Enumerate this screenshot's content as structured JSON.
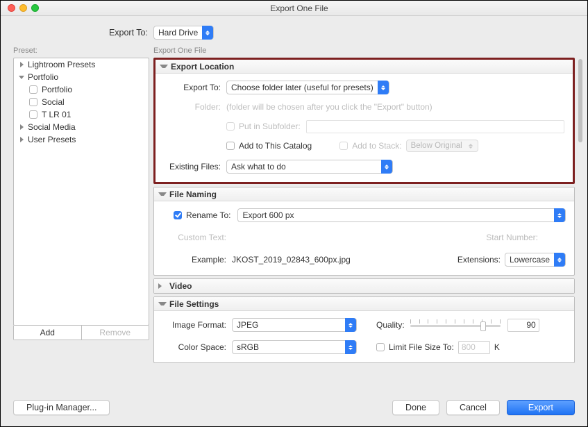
{
  "window": {
    "title": "Export One File"
  },
  "top": {
    "label": "Export To:",
    "value": "Hard Drive"
  },
  "preset": {
    "label": "Preset:",
    "items": [
      {
        "label": "Lightroom Presets",
        "expanded": false,
        "children": []
      },
      {
        "label": "Portfolio",
        "expanded": true,
        "children": [
          {
            "label": "Portfolio"
          },
          {
            "label": "Social"
          },
          {
            "label": "T LR 01"
          }
        ]
      },
      {
        "label": "Social Media",
        "expanded": false,
        "children": []
      },
      {
        "label": "User Presets",
        "expanded": false,
        "children": []
      }
    ],
    "add": "Add",
    "remove": "Remove"
  },
  "main_label": "Export One File",
  "loc": {
    "title": "Export Location",
    "export_to_label": "Export To:",
    "export_to_value": "Choose folder later (useful for presets)",
    "folder_label": "Folder:",
    "folder_hint": "(folder will be chosen after you click the \"Export\" button)",
    "subfolder_label": "Put in Subfolder:",
    "add_catalog_label": "Add to This Catalog",
    "add_stack_label": "Add to Stack:",
    "stack_value": "Below Original",
    "existing_label": "Existing Files:",
    "existing_value": "Ask what to do"
  },
  "naming": {
    "title": "File Naming",
    "rename_label": "Rename To:",
    "rename_value": "Export 600 px",
    "custom_label": "Custom Text:",
    "start_label": "Start Number:",
    "example_label": "Example:",
    "example_value": "JKOST_2019_02843_600px.jpg",
    "ext_label": "Extensions:",
    "ext_value": "Lowercase"
  },
  "video": {
    "title": "Video"
  },
  "fs": {
    "title": "File Settings",
    "format_label": "Image Format:",
    "format_value": "JPEG",
    "quality_label": "Quality:",
    "quality_value": "90",
    "colorspace_label": "Color Space:",
    "colorspace_value": "sRGB",
    "limit_label": "Limit File Size To:",
    "limit_placeholder": "800",
    "limit_unit": "K"
  },
  "footer": {
    "plugin": "Plug-in Manager...",
    "done": "Done",
    "cancel": "Cancel",
    "export": "Export"
  }
}
